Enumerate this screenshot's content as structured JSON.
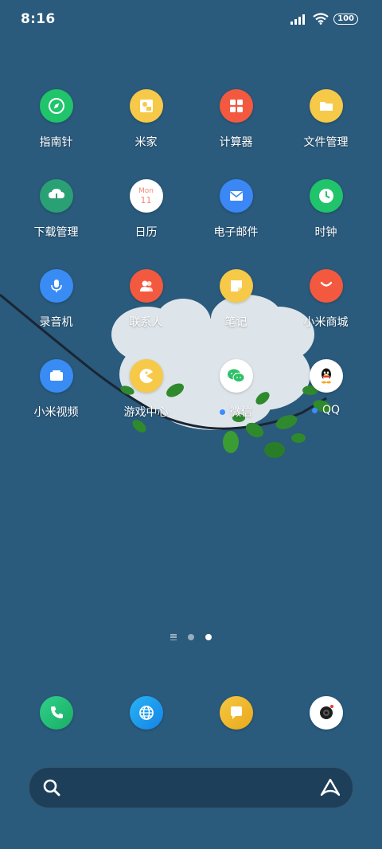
{
  "status": {
    "time": "8:16",
    "battery": "100"
  },
  "apps": [
    [
      {
        "label": "指南针",
        "icon": "compass-icon",
        "color": "#20c46b"
      },
      {
        "label": "米家",
        "icon": "mijia-icon",
        "color": "#f7c948"
      },
      {
        "label": "计算器",
        "icon": "calculator-icon",
        "color": "#f3593f"
      },
      {
        "label": "文件管理",
        "icon": "folder-icon",
        "color": "#f7c948"
      }
    ],
    [
      {
        "label": "下载管理",
        "icon": "download-cloud-icon",
        "color": "#2aa175"
      },
      {
        "label": "日历",
        "icon": "calendar-icon",
        "color": "#ffffff",
        "calendar_month": "Mon",
        "calendar_day": "11"
      },
      {
        "label": "电子邮件",
        "icon": "mail-icon",
        "color": "#3a87f5"
      },
      {
        "label": "时钟",
        "icon": "clock-icon",
        "color": "#20c46b"
      }
    ],
    [
      {
        "label": "录音机",
        "icon": "microphone-icon",
        "color": "#3a8cf5"
      },
      {
        "label": "联系人",
        "icon": "contacts-icon",
        "color": "#f3593f"
      },
      {
        "label": "笔记",
        "icon": "notes-icon",
        "color": "#f7c948"
      },
      {
        "label": "小米商城",
        "icon": "shop-icon",
        "color": "#f3593f"
      }
    ],
    [
      {
        "label": "小米视频",
        "icon": "video-icon",
        "color": "#3a8cf5"
      },
      {
        "label": "游戏中心",
        "icon": "game-icon",
        "color": "#f7c948"
      },
      {
        "label": "微信",
        "icon": "wechat-icon",
        "color": "#ffffff",
        "new_dot": true
      },
      {
        "label": "QQ",
        "icon": "qq-icon",
        "color": "#ffffff",
        "new_dot": true
      }
    ]
  ],
  "dock": [
    {
      "icon": "phone-icon",
      "color": "#22c173"
    },
    {
      "icon": "browser-icon",
      "color": "#1e9cf0"
    },
    {
      "icon": "messages-icon",
      "color": "#f0b92e"
    },
    {
      "icon": "camera-icon",
      "color": "#ffffff"
    }
  ],
  "pager": {
    "pages": 2,
    "active": 2
  }
}
